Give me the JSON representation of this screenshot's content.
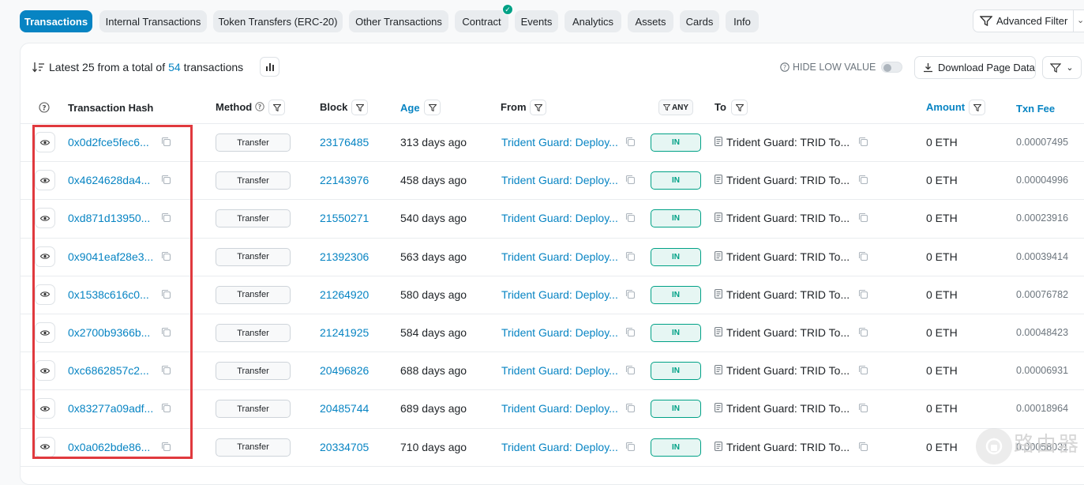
{
  "tabs": [
    {
      "label": "Transactions",
      "active": true
    },
    {
      "label": "Internal Transactions"
    },
    {
      "label": "Token Transfers (ERC-20)"
    },
    {
      "label": "Other Transactions"
    },
    {
      "label": "Contract",
      "verified": true
    },
    {
      "label": "Events"
    },
    {
      "label": "Analytics"
    },
    {
      "label": "Assets"
    },
    {
      "label": "Cards"
    },
    {
      "label": "Info"
    }
  ],
  "advanced_filter_label": "Advanced Filter",
  "summary": {
    "prefix": "Latest 25 from a total of",
    "count": "54",
    "suffix": "transactions"
  },
  "hide_low_value_label": "HIDE LOW VALUE",
  "download_label": "Download Page Data",
  "columns": {
    "hash": "Transaction Hash",
    "method": "Method",
    "block": "Block",
    "age": "Age",
    "from": "From",
    "direction_filter": "ANY",
    "to": "To",
    "amount": "Amount",
    "fee": "Txn Fee"
  },
  "rows": [
    {
      "hash": "0x0d2fce5fec6...",
      "method": "Transfer",
      "block": "23176485",
      "age": "313 days ago",
      "from": "Trident Guard: Deploy...",
      "direction": "IN",
      "to": "Trident Guard: TRID To...",
      "amount": "0 ETH",
      "fee": "0.00007495"
    },
    {
      "hash": "0x4624628da4...",
      "method": "Transfer",
      "block": "22143976",
      "age": "458 days ago",
      "from": "Trident Guard: Deploy...",
      "direction": "IN",
      "to": "Trident Guard: TRID To...",
      "amount": "0 ETH",
      "fee": "0.00004996"
    },
    {
      "hash": "0xd871d13950...",
      "method": "Transfer",
      "block": "21550271",
      "age": "540 days ago",
      "from": "Trident Guard: Deploy...",
      "direction": "IN",
      "to": "Trident Guard: TRID To...",
      "amount": "0 ETH",
      "fee": "0.00023916"
    },
    {
      "hash": "0x9041eaf28e3...",
      "method": "Transfer",
      "block": "21392306",
      "age": "563 days ago",
      "from": "Trident Guard: Deploy...",
      "direction": "IN",
      "to": "Trident Guard: TRID To...",
      "amount": "0 ETH",
      "fee": "0.00039414"
    },
    {
      "hash": "0x1538c616c0...",
      "method": "Transfer",
      "block": "21264920",
      "age": "580 days ago",
      "from": "Trident Guard: Deploy...",
      "direction": "IN",
      "to": "Trident Guard: TRID To...",
      "amount": "0 ETH",
      "fee": "0.00076782"
    },
    {
      "hash": "0x2700b9366b...",
      "method": "Transfer",
      "block": "21241925",
      "age": "584 days ago",
      "from": "Trident Guard: Deploy...",
      "direction": "IN",
      "to": "Trident Guard: TRID To...",
      "amount": "0 ETH",
      "fee": "0.00048423"
    },
    {
      "hash": "0xc6862857c2...",
      "method": "Transfer",
      "block": "20496826",
      "age": "688 days ago",
      "from": "Trident Guard: Deploy...",
      "direction": "IN",
      "to": "Trident Guard: TRID To...",
      "amount": "0 ETH",
      "fee": "0.00006931"
    },
    {
      "hash": "0x83277a09adf...",
      "method": "Transfer",
      "block": "20485744",
      "age": "689 days ago",
      "from": "Trident Guard: Deploy...",
      "direction": "IN",
      "to": "Trident Guard: TRID To...",
      "amount": "0 ETH",
      "fee": "0.00018964"
    },
    {
      "hash": "0x0a062bde86...",
      "method": "Transfer",
      "block": "20334705",
      "age": "710 days ago",
      "from": "Trident Guard: Deploy...",
      "direction": "IN",
      "to": "Trident Guard: TRID To...",
      "amount": "0 ETH",
      "fee": "0.00058031"
    }
  ],
  "watermark_text": "路由器",
  "colors": {
    "accent": "#0784c3",
    "in_badge": "#00a186",
    "highlight": "#e0393e"
  }
}
